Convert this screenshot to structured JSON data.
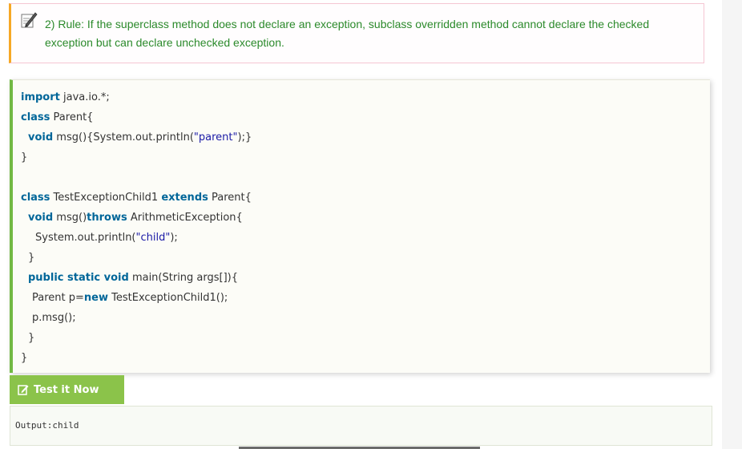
{
  "note": {
    "icon": "pencil-icon",
    "text": "2) Rule: If the superclass method does not declare an exception, subclass overridden method cannot declare the checked exception but can declare unchecked exception.",
    "border_color": "#f6a825",
    "text_color": "#2b8a2b"
  },
  "code": {
    "l1": {
      "k": "import",
      "t": " java.io.*;"
    },
    "l2": {
      "k": "class",
      "t": " Parent{"
    },
    "l3": {
      "k": "void",
      "t": " msg(){System.out.println(",
      "s": "\"parent\"",
      "e": ");}"
    },
    "l4": {
      "t": "}"
    },
    "l5": {
      "k": "class",
      "t": " TestExceptionChild1 ",
      "k2": "extends",
      "t2": " Parent{"
    },
    "l6": {
      "k": "void",
      "t": " msg()",
      "k2": "throws",
      "t2": " ArithmeticException{"
    },
    "l7": {
      "t": "System.out.println(",
      "s": "\"child\"",
      "e": ");"
    },
    "l8": {
      "t": "}"
    },
    "l9": {
      "k": "public static void",
      "t": " main(String args[]){"
    },
    "l10": {
      "t": "Parent p=",
      "k": "new",
      "t2": " TestExceptionChild1();"
    },
    "l11": {
      "t": "p.msg();"
    },
    "l12": {
      "t": "}"
    },
    "l13": {
      "t": "}"
    }
  },
  "test_button": {
    "label": "Test it Now",
    "icon": "edit-icon",
    "color": "#8bc34a"
  },
  "output": {
    "text": "Output:child"
  }
}
